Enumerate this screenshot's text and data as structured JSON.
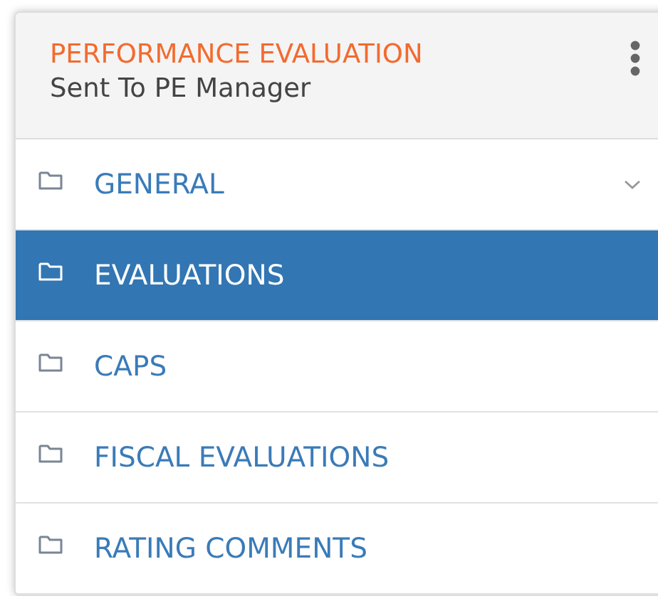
{
  "header": {
    "title": "PERFORMANCE EVALUATION",
    "status": "Sent To PE Manager"
  },
  "items": [
    {
      "label": "GENERAL",
      "selected": false,
      "expandable": true
    },
    {
      "label": "EVALUATIONS",
      "selected": true,
      "expandable": false
    },
    {
      "label": "CAPS",
      "selected": false,
      "expandable": false
    },
    {
      "label": "FISCAL EVALUATIONS",
      "selected": false,
      "expandable": false
    },
    {
      "label": "RATING COMMENTS",
      "selected": false,
      "expandable": false
    }
  ]
}
